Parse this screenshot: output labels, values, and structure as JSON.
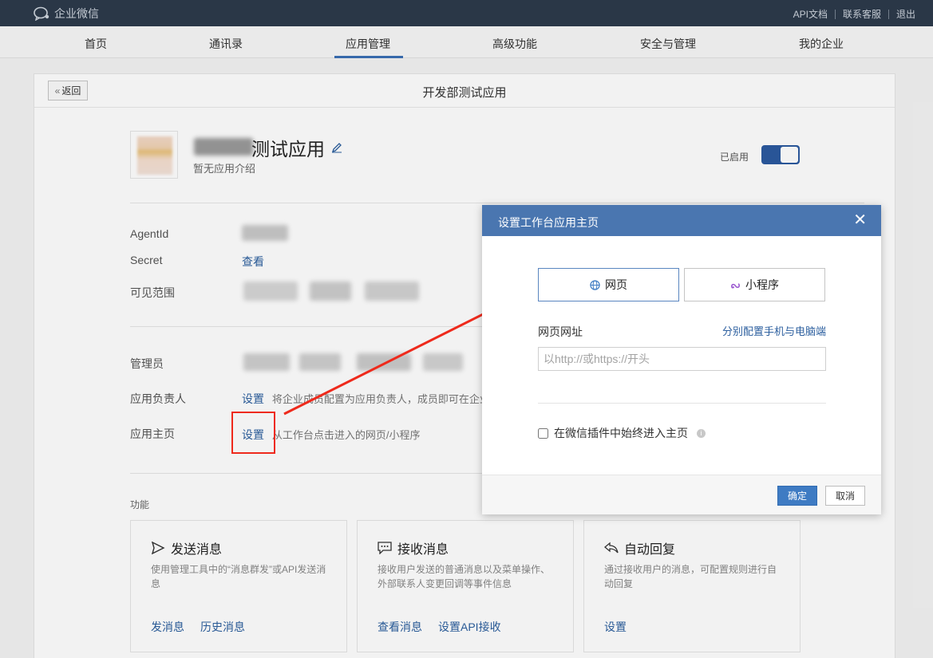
{
  "topbar": {
    "logo_text": "企业微信",
    "links": [
      "API文档",
      "联系客服",
      "退出"
    ]
  },
  "nav": {
    "items": [
      "首页",
      "通讯录",
      "应用管理",
      "高级功能",
      "安全与管理",
      "我的企业"
    ],
    "active": "应用管理"
  },
  "panel": {
    "back_label": "返回",
    "title": "开发部测试应用"
  },
  "app": {
    "name_suffix": "测试应用",
    "desc": "暂无应用介绍",
    "status_label": "已启用",
    "enabled": true
  },
  "info": {
    "agentid_label": "AgentId",
    "secret_label": "Secret",
    "secret_link": "查看",
    "visible_label": "可见范围",
    "admin_label": "管理员",
    "owner_label": "应用负责人",
    "owner_link": "设置",
    "owner_hint": "将企业成员配置为应用负责人，成员即可在企业",
    "homepage_label": "应用主页",
    "homepage_link": "设置",
    "homepage_hint": "从工作台点击进入的网页/小程序"
  },
  "features": {
    "section_label": "功能",
    "cards": [
      {
        "icon": "send-icon",
        "title": "发送消息",
        "desc": "使用管理工具中的“消息群发”或API发送消息",
        "links": [
          "发消息",
          "历史消息"
        ]
      },
      {
        "icon": "chat-icon",
        "title": "接收消息",
        "desc": "接收用户发送的普通消息以及菜单操作、外部联系人变更回调等事件信息",
        "links": [
          "查看消息",
          "设置API接收"
        ]
      },
      {
        "icon": "reply-icon",
        "title": "自动回复",
        "desc": "通过接收用户的消息，可配置规则进行自动回复",
        "links": [
          "设置"
        ]
      }
    ]
  },
  "dialog": {
    "title": "设置工作台应用主页",
    "tab_web": "网页",
    "tab_miniprogram": "小程序",
    "url_label": "网页网址",
    "split_config_link": "分别配置手机与电脑端",
    "url_placeholder": "以http://或https://开头",
    "url_value": "",
    "checkbox_label": "在微信插件中始终进入主页",
    "ok_label": "确定",
    "cancel_label": "取消"
  },
  "colors": {
    "topbar_bg": "#2d3a4b",
    "accent_blue": "#3e7bc3",
    "link_blue": "#2b5e9e",
    "dialog_header": "#4a76b0",
    "annotation_red": "#ee2a1c"
  }
}
